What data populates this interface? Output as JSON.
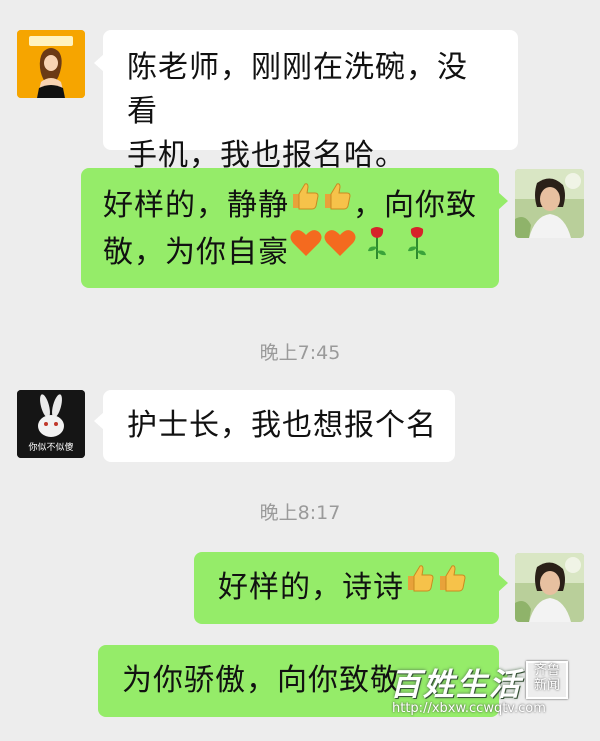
{
  "messages": [
    {
      "id": "msg1",
      "side": "incoming",
      "text_line1": "陈老师，刚刚在洗碗，没看",
      "text_line2": "手机，我也报名哈。"
    },
    {
      "id": "msg2",
      "side": "outgoing",
      "text_line1_a": "好样的，静静",
      "text_line1_b": "，向你致",
      "text_line2": "敬，为你自豪",
      "emojis": [
        "thumbs-up",
        "thumbs-up",
        "orange-heart",
        "orange-heart",
        "rose",
        "rose"
      ]
    },
    {
      "id": "time1",
      "text": "晚上7:45"
    },
    {
      "id": "msg3",
      "side": "incoming",
      "text": "护士长，我也想报个名",
      "avatar_caption": "你似不似傻"
    },
    {
      "id": "time2",
      "text": "晚上8:17"
    },
    {
      "id": "msg4",
      "side": "outgoing",
      "text": "好样的，诗诗",
      "emojis": [
        "thumbs-up",
        "thumbs-up"
      ]
    },
    {
      "id": "msg5",
      "side": "outgoing",
      "text": "为你骄傲，向你致敬"
    }
  ],
  "watermark": {
    "brand": "百姓生活",
    "seal_line1": "齐鲁",
    "seal_line2": "新闻",
    "url": "http://xbxw.ccwqtv.com"
  },
  "colors": {
    "background": "#ededed",
    "incoming_bubble": "#ffffff",
    "outgoing_bubble": "#95ec69",
    "timestamp": "#9a9a9a"
  }
}
